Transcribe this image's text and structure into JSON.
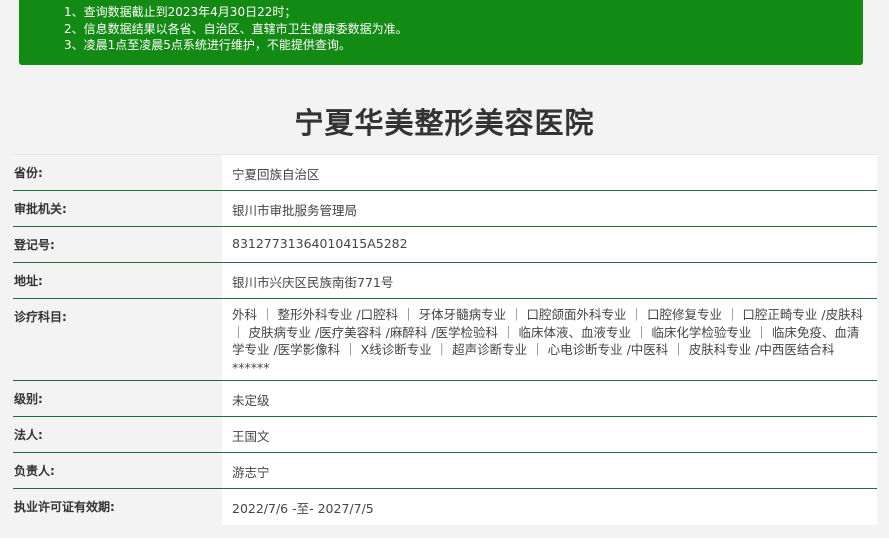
{
  "notice": {
    "lines": [
      "1、查询数据截止到2023年4月30日22时；",
      "2、信息数据结果以各省、自治区、直辖市卫生健康委数据为准。",
      "3、凌晨1点至凌晨5点系统进行维护，不能提供查询。"
    ]
  },
  "hospital": {
    "name": "宁夏华美整形美容医院"
  },
  "fields": [
    {
      "label": "省份:",
      "value": "宁夏回族自治区"
    },
    {
      "label": "审批机关:",
      "value": "银川市审批服务管理局"
    },
    {
      "label": "登记号:",
      "value": "83127731364010415A5282"
    },
    {
      "label": "地址:",
      "value": "银川市兴庆区民族南街771号"
    },
    {
      "label": "诊疗科目:",
      "value": "外科 ｜ 整形外科专业 /口腔科 ｜ 牙体牙髓病专业 ｜ 口腔颌面外科专业 ｜ 口腔修复专业 ｜ 口腔正畸专业 /皮肤科 ｜ 皮肤病专业 /医疗美容科 /麻醉科 /医学检验科 ｜ 临床体液、血液专业 ｜ 临床化学检验专业 ｜ 临床免疫、血清学专业 /医学影像科 ｜ X线诊断专业 ｜ 超声诊断专业 ｜ 心电诊断专业 /中医科 ｜ 皮肤科专业 /中西医结合科 ******"
    },
    {
      "label": "级别:",
      "value": "未定级"
    },
    {
      "label": "法人:",
      "value": "王国文"
    },
    {
      "label": "负责人:",
      "value": "游志宁"
    },
    {
      "label": "执业许可证有效期:",
      "value": "2022/7/6 -至- 2027/7/5"
    }
  ]
}
